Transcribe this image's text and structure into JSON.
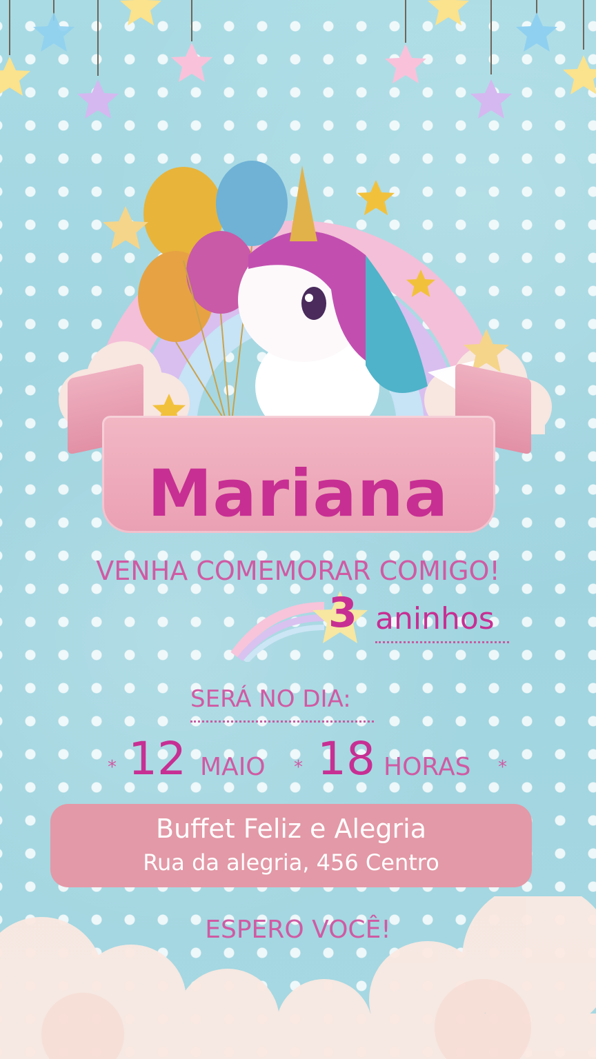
{
  "invite": {
    "name": "Mariana",
    "subtitle": "VENHA COMEMORAR COMIGO!",
    "age_number": "3",
    "age_word": "aninhos",
    "date_label": "SERÁ NO DIA:",
    "day": "12",
    "month": "MAIO",
    "hour": "18",
    "hour_word": "HORAS",
    "separator": "*",
    "venue_name": "Buffet Feliz e Alegria",
    "venue_address": "Rua da alegria, 456 Centro",
    "closing": "ESPERO VOCÊ!"
  },
  "colors": {
    "background": "#a6d8e2",
    "name": "#c72f93",
    "text_pink": "#d05aa3",
    "banner": "#eaa0b3",
    "venue_box": "#e399a7"
  },
  "icons": [
    "hanging-star-icon",
    "balloon-icon",
    "unicorn-illustration",
    "rainbow-icon",
    "cloud-icon",
    "gold-star-icon"
  ]
}
